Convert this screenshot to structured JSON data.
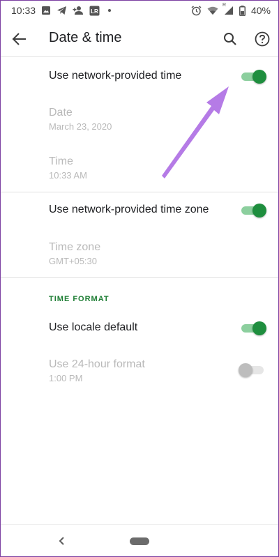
{
  "status_bar": {
    "time": "10:33",
    "battery": "40%",
    "icons": [
      "image-icon",
      "telegram-icon",
      "person-add-icon",
      "lr-icon",
      "dot-icon",
      "alarm-icon",
      "wifi-icon",
      "signal-icon",
      "battery-icon"
    ],
    "lr_label": "LR",
    "signal_label": "R"
  },
  "app_bar": {
    "title": "Date & time"
  },
  "settings": {
    "network_time": {
      "title": "Use network-provided time",
      "enabled": true
    },
    "date": {
      "title": "Date",
      "value": "March 23, 2020"
    },
    "time": {
      "title": "Time",
      "value": "10:33 AM"
    },
    "network_zone": {
      "title": "Use network-provided time zone",
      "enabled": true
    },
    "time_zone": {
      "title": "Time zone",
      "value": "GMT+05:30"
    },
    "time_format_header": "TIME FORMAT",
    "locale_default": {
      "title": "Use locale default",
      "enabled": true
    },
    "hour_24": {
      "title": "Use 24-hour format",
      "value": "1:00 PM",
      "enabled": false
    }
  },
  "colors": {
    "accent": "#1e8e3e",
    "annotation_arrow": "#b57be6",
    "frame": "#7b3fa1"
  }
}
